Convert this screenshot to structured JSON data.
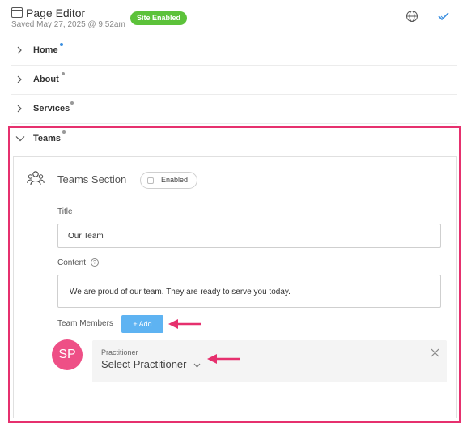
{
  "header": {
    "title": "Page Editor",
    "saved": "Saved May 27, 2025 @ 9:52am",
    "badge": "Site Enabled",
    "icons": [
      "calendar-icon",
      "globe-icon",
      "check-icon"
    ]
  },
  "nav": {
    "items": [
      {
        "label": "Home",
        "dot_color": "#3b8fe0"
      },
      {
        "label": "About",
        "dot_color": "#999999"
      },
      {
        "label": "Services",
        "dot_color": "#999999"
      },
      {
        "label": "Teams",
        "dot_color": "#999999"
      }
    ]
  },
  "section": {
    "title": "Teams Section",
    "toggle_label": "Enabled",
    "title_label": "Title",
    "title_value": "Our Team",
    "content_label": "Content",
    "help_glyph": "?",
    "content_value": "We are proud of our team. They are ready to serve you today.",
    "members_label": "Team Members",
    "add_label": "+ Add"
  },
  "member": {
    "initials": "SP",
    "field_label": "Practitioner",
    "select_text": "Select Practitioner"
  },
  "colors": {
    "highlight": "#e6306e",
    "badge": "#5cc23a",
    "add_button": "#5eb3f2",
    "avatar": "#ee4f86",
    "arrow": "#e6306e"
  }
}
